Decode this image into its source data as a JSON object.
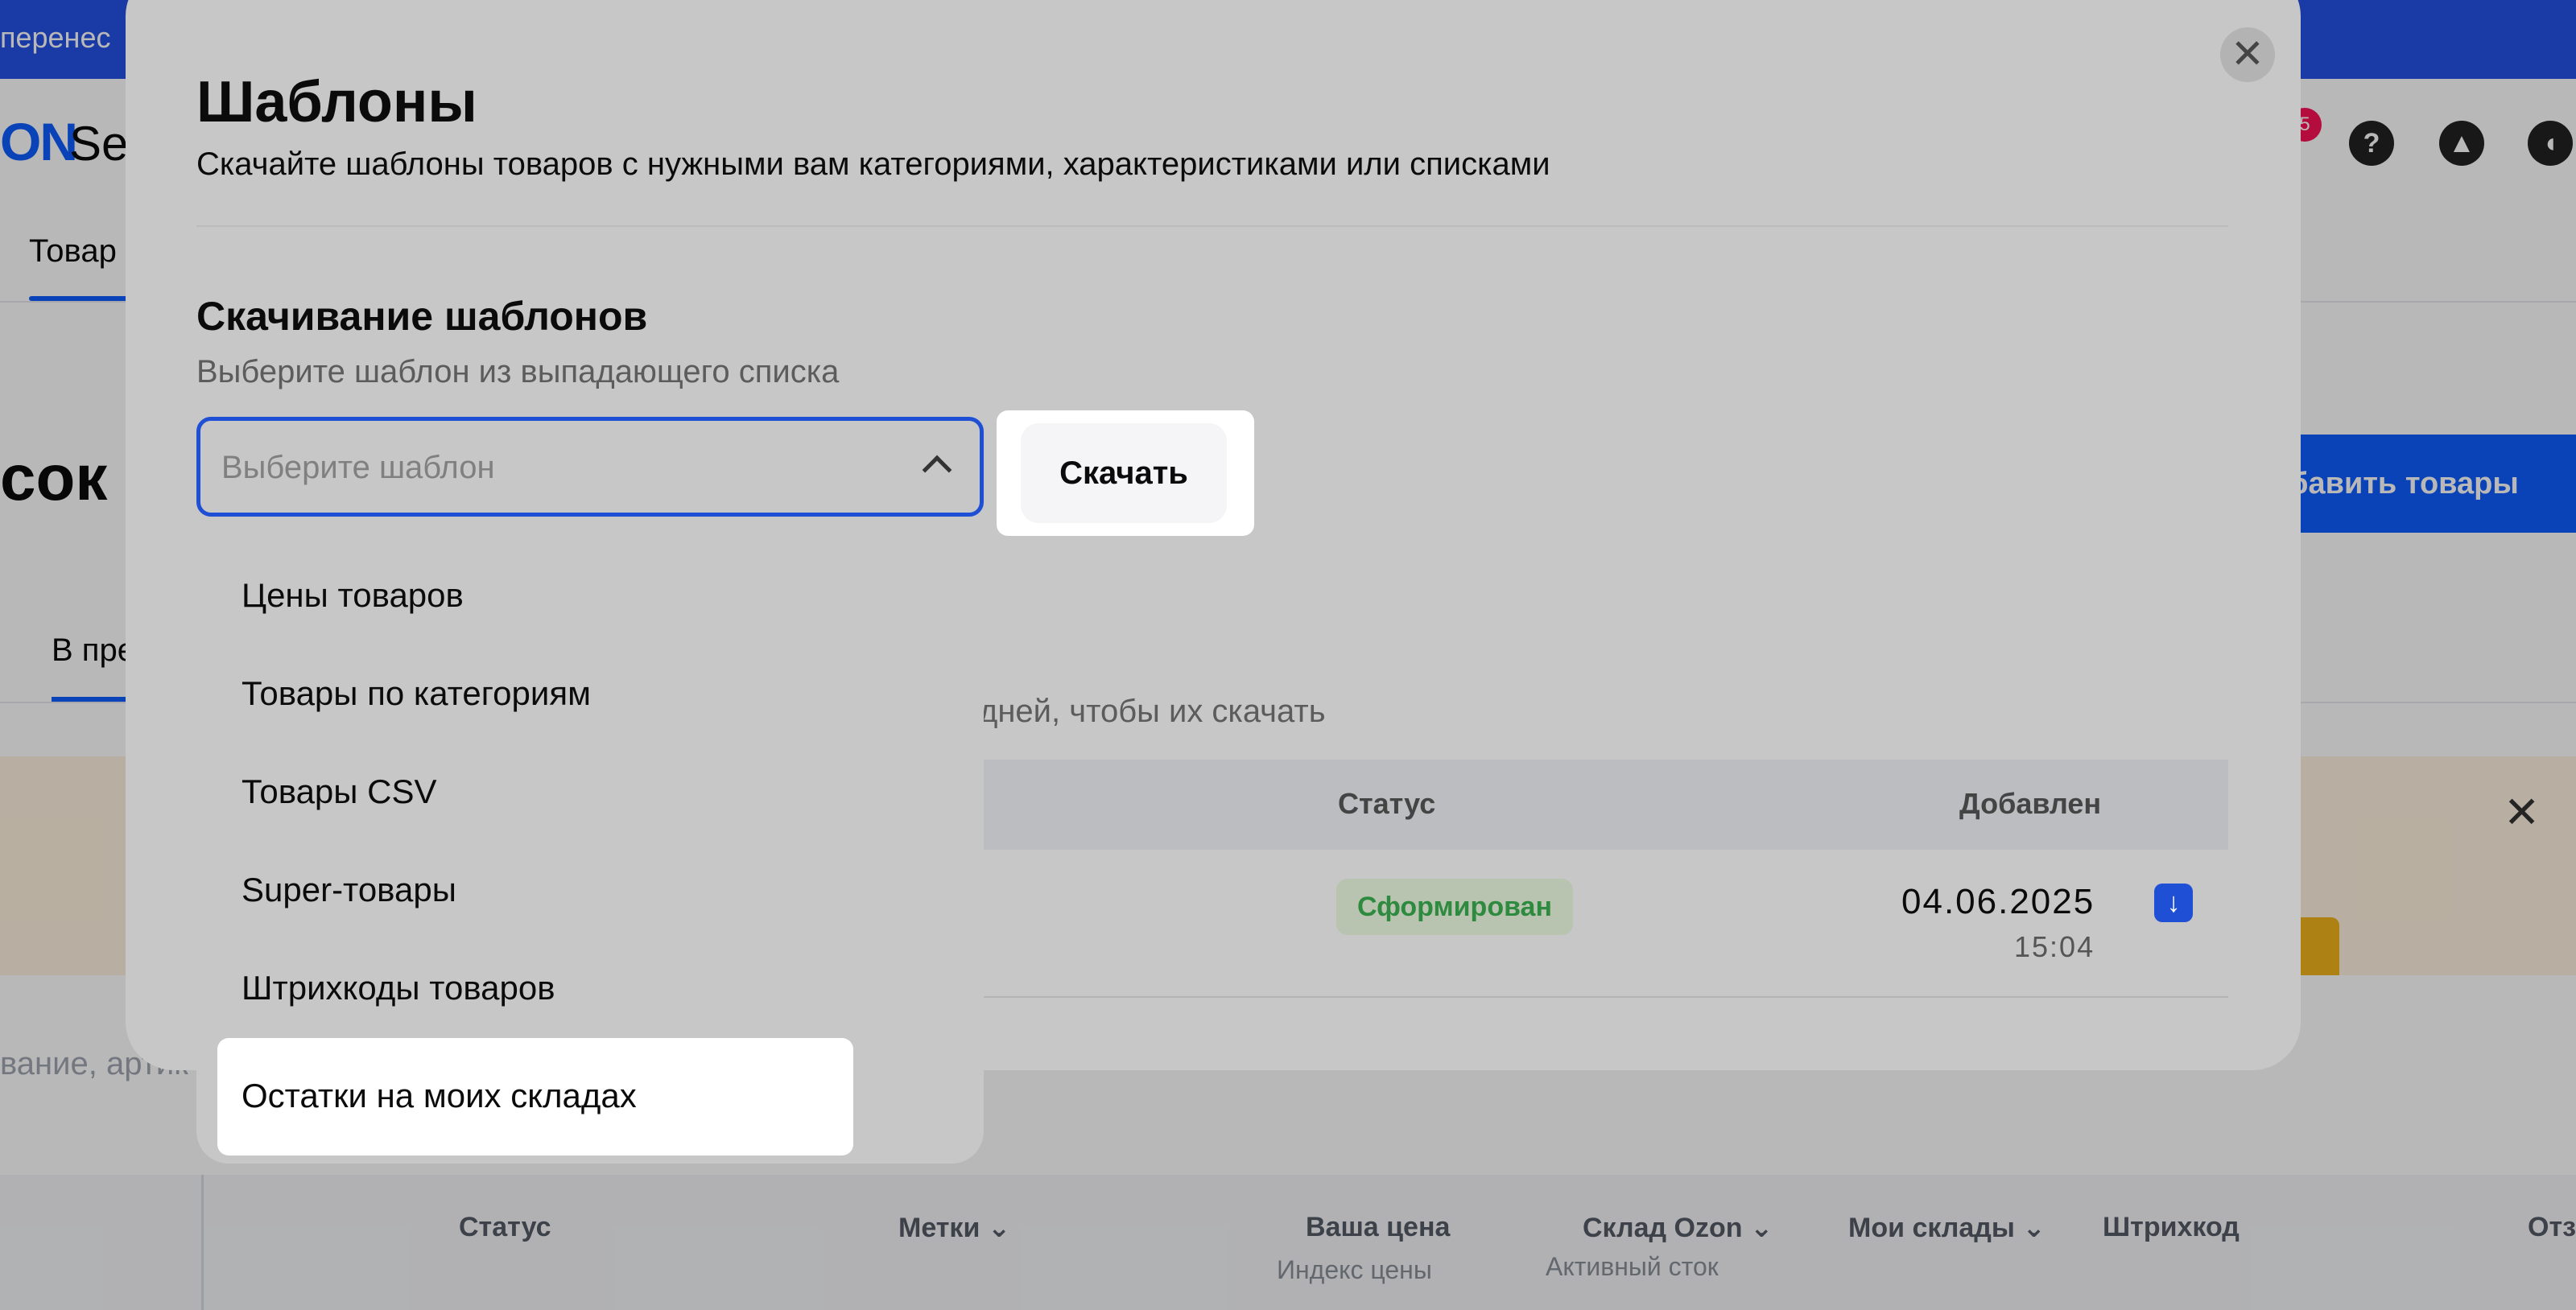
{
  "background": {
    "banner_text": "перенес",
    "logo": "ON",
    "logo_suffix": "Sel",
    "notification_count": "5",
    "help_icon_glyph": "?",
    "learn_icon_glyph": "▲",
    "announce_icon_glyph": "◖",
    "nav_tab": "Товар",
    "page_heading": "сок",
    "add_button": "бавить товары",
    "sub_tab": "В пре",
    "search_placeholder": "вание, артик",
    "promo_close_glyph": "✕",
    "table_headers": {
      "status": "Статус",
      "tags": "Метки",
      "your_price": "Ваша цена",
      "price_index": "Индекс цены",
      "ozon_warehouse": "Склад Ozon",
      "active_stock": "Активный сток",
      "my_warehouses": "Мои склады",
      "barcode": "Штрихкод",
      "reviews": "Отз"
    },
    "chevron_glyph": "⌄"
  },
  "modal": {
    "close_glyph": "✕",
    "title": "Шаблоны",
    "subtitle": "Скачайте шаблоны товаров с нужными вам категориями, характеристиками или списками",
    "section_title": "Скачивание шаблонов",
    "section_subtitle": "Выберите шаблон из выпадающего списка",
    "select_placeholder": "Выберите шаблон",
    "download_button": "Скачать",
    "files_note": "дней, чтобы их скачать",
    "table": {
      "col_status": "Статус",
      "col_added": "Добавлен",
      "row": {
        "status": "Сформирован",
        "date": "04.06.2025",
        "time": "15:04",
        "download_glyph": "↓"
      }
    },
    "dropdown_items": [
      "Цены товаров",
      "Товары по категориям",
      "Товары CSV",
      "Super-товары",
      "Штрихкоды товаров",
      "Остатки на моих складах"
    ]
  },
  "colors": {
    "brand_blue": "#0f5cff",
    "select_border": "#1f4fd4",
    "status_green": "#2e8a3e"
  }
}
